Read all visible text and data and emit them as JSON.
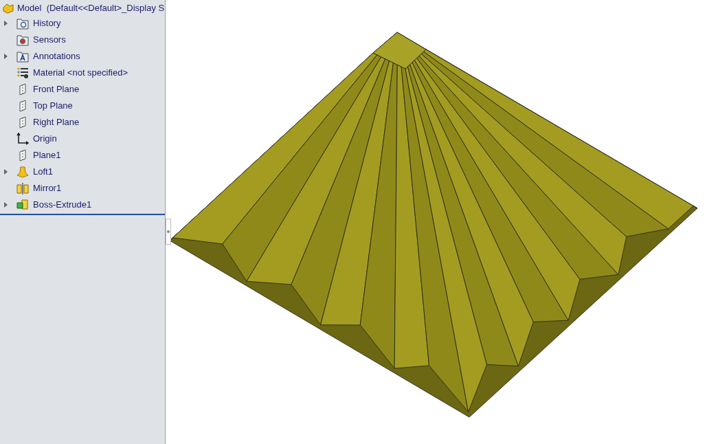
{
  "tree": {
    "root": {
      "label": "Model  (Default<<Default>_Display S"
    },
    "items": [
      {
        "label": "History",
        "kind": "history",
        "expandable": true
      },
      {
        "label": "Sensors",
        "kind": "sensors",
        "expandable": false
      },
      {
        "label": "Annotations",
        "kind": "annotations",
        "expandable": true
      },
      {
        "label": "Material <not specified>",
        "kind": "material",
        "expandable": false
      },
      {
        "label": "Front Plane",
        "kind": "plane",
        "expandable": false
      },
      {
        "label": "Top Plane",
        "kind": "plane",
        "expandable": false
      },
      {
        "label": "Right Plane",
        "kind": "plane",
        "expandable": false
      },
      {
        "label": "Origin",
        "kind": "origin",
        "expandable": false
      },
      {
        "label": "Plane1",
        "kind": "plane",
        "expandable": false
      },
      {
        "label": "Loft1",
        "kind": "loft",
        "expandable": true
      },
      {
        "label": "Mirror1",
        "kind": "mirror",
        "expandable": false
      },
      {
        "label": "Boss-Extrude1",
        "kind": "extrude",
        "expandable": true
      }
    ]
  }
}
